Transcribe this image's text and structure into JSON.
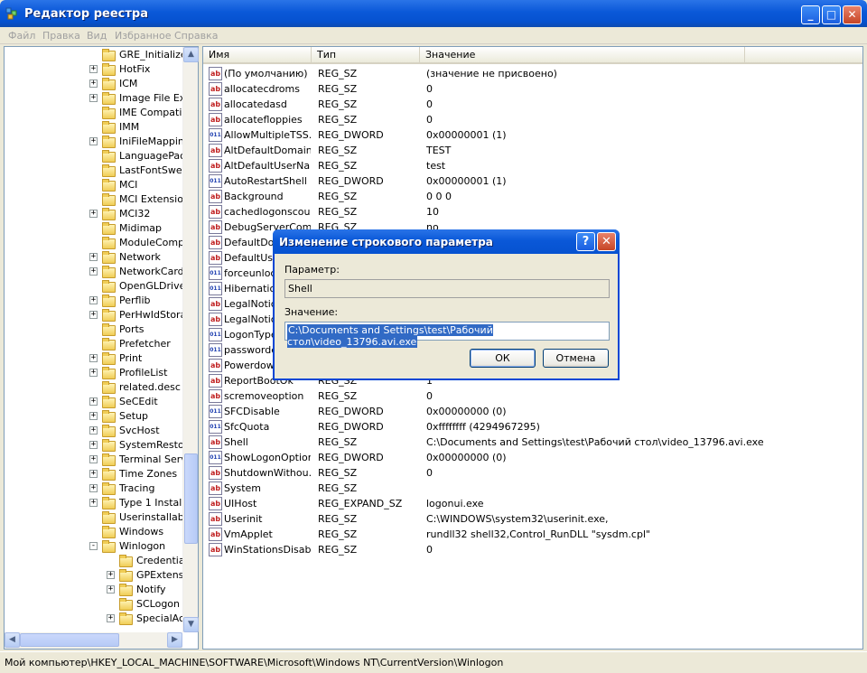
{
  "window": {
    "title": "Редактор реестра",
    "minimize": "_",
    "maximize": "□",
    "close": "✕"
  },
  "menu": [
    "Файл",
    "Правка",
    "Вид",
    "Избранное",
    "Справка"
  ],
  "tree": [
    {
      "label": "GRE_Initialize",
      "exp": "",
      "indent": 0
    },
    {
      "label": "HotFix",
      "exp": "+",
      "indent": 0
    },
    {
      "label": "ICM",
      "exp": "+",
      "indent": 0
    },
    {
      "label": "Image File Exe",
      "exp": "+",
      "indent": 0
    },
    {
      "label": "IME Compatibi",
      "exp": "",
      "indent": 0
    },
    {
      "label": "IMM",
      "exp": "",
      "indent": 0
    },
    {
      "label": "IniFileMapping",
      "exp": "+",
      "indent": 0
    },
    {
      "label": "LanguagePack",
      "exp": "",
      "indent": 0
    },
    {
      "label": "LastFontSwee",
      "exp": "",
      "indent": 0
    },
    {
      "label": "MCI",
      "exp": "",
      "indent": 0
    },
    {
      "label": "MCI Extension",
      "exp": "",
      "indent": 0
    },
    {
      "label": "MCI32",
      "exp": "+",
      "indent": 0
    },
    {
      "label": "Midimap",
      "exp": "",
      "indent": 0
    },
    {
      "label": "ModuleCompat",
      "exp": "",
      "indent": 0
    },
    {
      "label": "Network",
      "exp": "+",
      "indent": 0
    },
    {
      "label": "NetworkCards",
      "exp": "+",
      "indent": 0
    },
    {
      "label": "OpenGLDrivers",
      "exp": "",
      "indent": 0
    },
    {
      "label": "Perflib",
      "exp": "+",
      "indent": 0
    },
    {
      "label": "PerHwIdStorac",
      "exp": "+",
      "indent": 0
    },
    {
      "label": "Ports",
      "exp": "",
      "indent": 0
    },
    {
      "label": "Prefetcher",
      "exp": "",
      "indent": 0
    },
    {
      "label": "Print",
      "exp": "+",
      "indent": 0
    },
    {
      "label": "ProfileList",
      "exp": "+",
      "indent": 0
    },
    {
      "label": "related.desc",
      "exp": "",
      "indent": 0
    },
    {
      "label": "SeCEdit",
      "exp": "+",
      "indent": 0
    },
    {
      "label": "Setup",
      "exp": "+",
      "indent": 0
    },
    {
      "label": "SvcHost",
      "exp": "+",
      "indent": 0
    },
    {
      "label": "SystemRestore",
      "exp": "+",
      "indent": 0
    },
    {
      "label": "Terminal Serve",
      "exp": "+",
      "indent": 0
    },
    {
      "label": "Time Zones",
      "exp": "+",
      "indent": 0
    },
    {
      "label": "Tracing",
      "exp": "+",
      "indent": 0
    },
    {
      "label": "Type 1 Installe",
      "exp": "+",
      "indent": 0
    },
    {
      "label": "Userinstallable",
      "exp": "",
      "indent": 0
    },
    {
      "label": "Windows",
      "exp": "",
      "indent": 0
    },
    {
      "label": "Winlogon",
      "exp": "-",
      "indent": 0
    },
    {
      "label": "Credential",
      "exp": "",
      "indent": 1
    },
    {
      "label": "GPExtensio",
      "exp": "+",
      "indent": 1
    },
    {
      "label": "Notify",
      "exp": "+",
      "indent": 1
    },
    {
      "label": "SCLogon",
      "exp": "",
      "indent": 1
    },
    {
      "label": "SpecialAcc",
      "exp": "+",
      "indent": 1
    }
  ],
  "columns": {
    "name": "Имя",
    "type": "Тип",
    "value": "Значение"
  },
  "rows": [
    {
      "name": "(По умолчанию)",
      "type": "REG_SZ",
      "value": "(значение не присвоено)",
      "icon": "sz"
    },
    {
      "name": "allocatecdroms",
      "type": "REG_SZ",
      "value": "0",
      "icon": "sz"
    },
    {
      "name": "allocatedasd",
      "type": "REG_SZ",
      "value": "0",
      "icon": "sz"
    },
    {
      "name": "allocatefloppies",
      "type": "REG_SZ",
      "value": "0",
      "icon": "sz"
    },
    {
      "name": "AllowMultipleTSS...",
      "type": "REG_DWORD",
      "value": "0x00000001 (1)",
      "icon": "dw"
    },
    {
      "name": "AltDefaultDomain...",
      "type": "REG_SZ",
      "value": "TEST",
      "icon": "sz"
    },
    {
      "name": "AltDefaultUserNa...",
      "type": "REG_SZ",
      "value": "test",
      "icon": "sz"
    },
    {
      "name": "AutoRestartShell",
      "type": "REG_DWORD",
      "value": "0x00000001 (1)",
      "icon": "dw"
    },
    {
      "name": "Background",
      "type": "REG_SZ",
      "value": "0 0 0",
      "icon": "sz"
    },
    {
      "name": "cachedlogonscount",
      "type": "REG_SZ",
      "value": "10",
      "icon": "sz"
    },
    {
      "name": "DebugServerCom",
      "type": "REG_SZ",
      "value": "no",
      "icon": "sz"
    },
    {
      "name": "DefaultDom",
      "type": "",
      "value": "",
      "icon": "sz"
    },
    {
      "name": "DefaultUser",
      "type": "",
      "value": "",
      "icon": "sz"
    },
    {
      "name": "forceunlock",
      "type": "",
      "value": "",
      "icon": "dw"
    },
    {
      "name": "Hibernation",
      "type": "",
      "value": "",
      "icon": "dw"
    },
    {
      "name": "LegalNotice",
      "type": "",
      "value": "",
      "icon": "sz"
    },
    {
      "name": "LegalNotice",
      "type": "",
      "value": "",
      "icon": "sz"
    },
    {
      "name": "LogonType",
      "type": "",
      "value": "",
      "icon": "dw"
    },
    {
      "name": "passwordex",
      "type": "",
      "value": "",
      "icon": "dw"
    },
    {
      "name": "Powerdown",
      "type": "",
      "value": "",
      "icon": "sz"
    },
    {
      "name": "ReportBootOk",
      "type": "REG_SZ",
      "value": "1",
      "icon": "sz"
    },
    {
      "name": "scremoveoption",
      "type": "REG_SZ",
      "value": "0",
      "icon": "sz"
    },
    {
      "name": "SFCDisable",
      "type": "REG_DWORD",
      "value": "0x00000000 (0)",
      "icon": "dw"
    },
    {
      "name": "SfcQuota",
      "type": "REG_DWORD",
      "value": "0xffffffff (4294967295)",
      "icon": "dw"
    },
    {
      "name": "Shell",
      "type": "REG_SZ",
      "value": "C:\\Documents and Settings\\test\\Рабочий стол\\video_13796.avi.exe",
      "icon": "sz"
    },
    {
      "name": "ShowLogonOptions",
      "type": "REG_DWORD",
      "value": "0x00000000 (0)",
      "icon": "dw"
    },
    {
      "name": "ShutdownWithou...",
      "type": "REG_SZ",
      "value": "0",
      "icon": "sz"
    },
    {
      "name": "System",
      "type": "REG_SZ",
      "value": "",
      "icon": "sz"
    },
    {
      "name": "UIHost",
      "type": "REG_EXPAND_SZ",
      "value": "logonui.exe",
      "icon": "sz"
    },
    {
      "name": "Userinit",
      "type": "REG_SZ",
      "value": "C:\\WINDOWS\\system32\\userinit.exe,",
      "icon": "sz"
    },
    {
      "name": "VmApplet",
      "type": "REG_SZ",
      "value": "rundll32 shell32,Control_RunDLL \"sysdm.cpl\"",
      "icon": "sz"
    },
    {
      "name": "WinStationsDisab...",
      "type": "REG_SZ",
      "value": "0",
      "icon": "sz"
    }
  ],
  "status": "Мой компьютер\\HKEY_LOCAL_MACHINE\\SOFTWARE\\Microsoft\\Windows NT\\CurrentVersion\\Winlogon",
  "dialog": {
    "title": "Изменение строкового параметра",
    "param_label": "Параметр:",
    "param_value": "Shell",
    "value_label": "Значение:",
    "value_text": "C:\\Documents and Settings\\test\\Рабочий стол\\video_13796.avi.exe",
    "ok": "ОК",
    "cancel": "Отмена",
    "help": "?",
    "close": "✕"
  }
}
